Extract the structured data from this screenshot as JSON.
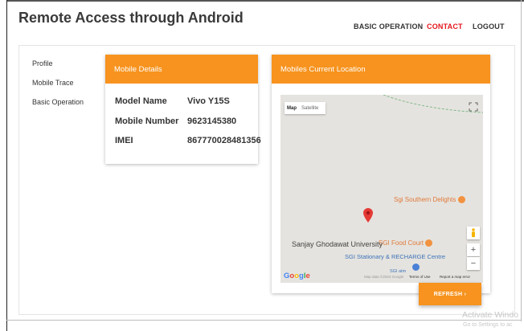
{
  "header": {
    "brand": "Remote Access through Android",
    "nav": [
      "BASIC OPERATION",
      "CONTACT",
      "LOGOUT"
    ],
    "active_color": "#e4161c"
  },
  "sidebar": {
    "items": [
      "Profile",
      "Mobile Trace",
      "Basic Operation"
    ]
  },
  "details": {
    "header": "Mobile Details",
    "rows": [
      {
        "label": "Model Name",
        "value": "Vivo Y15S"
      },
      {
        "label": "Mobile Number",
        "value": "9623145380"
      },
      {
        "label": "IMEI",
        "value": "867770028481356"
      }
    ]
  },
  "map": {
    "header": "Mobiles Current Location",
    "maptype": [
      "Map",
      "Satellite"
    ],
    "pois": {
      "southern": "Sgi Southern Delights",
      "food": "SGI Food Court",
      "stationary": "SGI Stationary & RECHARGE Centre",
      "atm": "SGI atm",
      "campus": "Sanjay Ghodawat University"
    },
    "google": [
      "G",
      "o",
      "o",
      "g",
      "l",
      "e"
    ],
    "footer": {
      "mapdata": "Map data ©2023 Google",
      "terms": "Terms of Use",
      "report": "Report a map error"
    },
    "zoom_in": "+",
    "zoom_out": "−"
  },
  "refresh_button": "REFRESH ›",
  "os_watermark": {
    "line1": "Activate Windo",
    "line2": "Go to Settings to ac"
  },
  "colors": {
    "accent": "#f7931e",
    "marker": "#e53935"
  }
}
